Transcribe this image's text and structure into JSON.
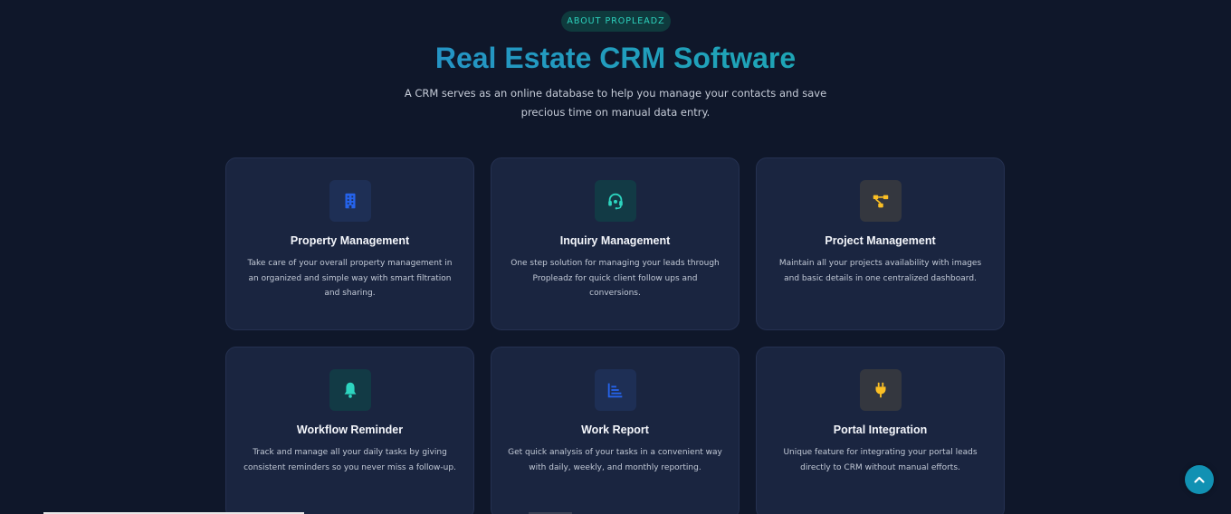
{
  "header": {
    "badge": "ABOUT PROPLEADZ",
    "title": "Real Estate CRM Software",
    "subtitle": "A CRM serves as an online database to help you manage your contacts and save precious time on manual data entry."
  },
  "colors": {
    "background": "#0f172a",
    "card_background": "#1a2540",
    "accent_teal": "#2dd4bf",
    "accent_blue": "#2563eb",
    "accent_amber": "#fbbf24",
    "scroll_button": "#1191b3"
  },
  "features": [
    {
      "icon": "building-icon",
      "title": "Property Management",
      "description": "Take care of your overall property management in an organized and simple way with smart filtration and sharing."
    },
    {
      "icon": "headset-icon",
      "title": "Inquiry Management",
      "description": "One step solution for managing your leads through Propleadz for quick client follow ups and conversions."
    },
    {
      "icon": "project-diagram-icon",
      "title": "Project Management",
      "description": "Maintain all your projects availability with images and basic details in one centralized dashboard."
    },
    {
      "icon": "bell-icon",
      "title": "Workflow Reminder",
      "description": "Track and manage all your daily tasks by giving consistent reminders so you never miss a follow-up."
    },
    {
      "icon": "chart-icon",
      "title": "Work Report",
      "description": "Get quick analysis of your tasks in a convenient way with daily, weekly, and monthly reporting."
    },
    {
      "icon": "plug-icon",
      "title": "Portal Integration",
      "description": "Unique feature for integrating your portal leads directly to CRM without manual efforts."
    }
  ],
  "scroll_top": {
    "icon": "chevron-up-icon"
  }
}
